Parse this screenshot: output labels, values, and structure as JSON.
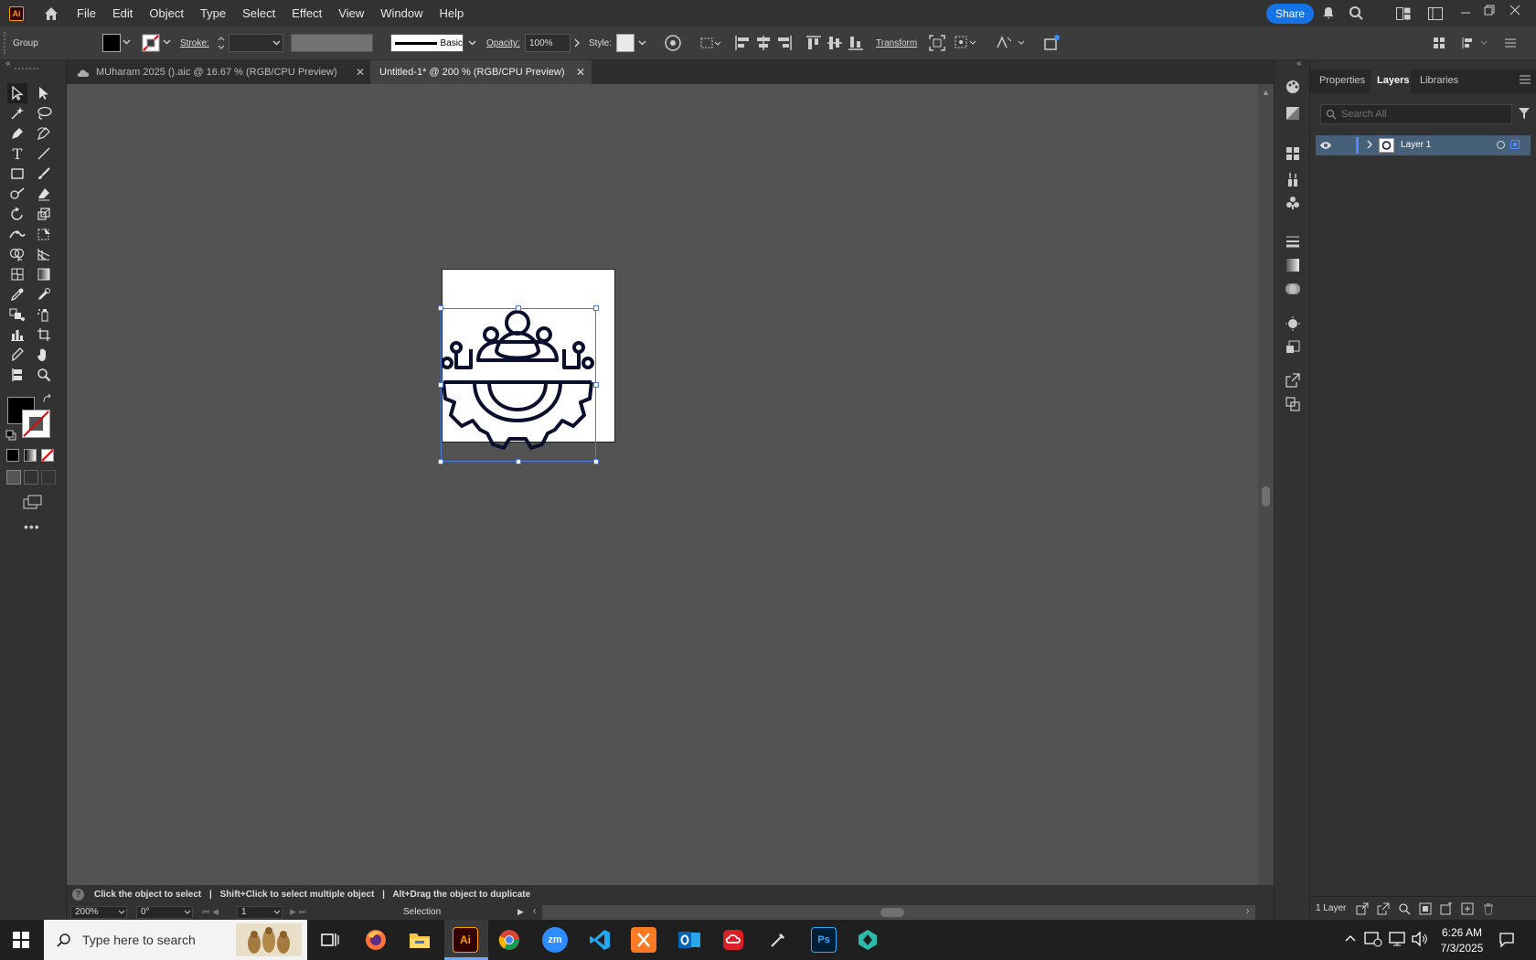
{
  "app": {
    "logo": "Ai",
    "menus": [
      "File",
      "Edit",
      "Object",
      "Type",
      "Select",
      "Effect",
      "View",
      "Window",
      "Help"
    ],
    "share_label": "Share"
  },
  "control_bar": {
    "selection_type": "Group",
    "stroke_label": "Stroke:",
    "stroke_profile": "Basic",
    "opacity_label": "Opacity:",
    "opacity_value": "100%",
    "style_label": "Style:",
    "transform_label": "Transform"
  },
  "tabs": [
    {
      "label": "MUharam 2025 ().aic @ 16.67 % (RGB/CPU Preview)",
      "active": false
    },
    {
      "label": "Untitled-1* @ 200 % (RGB/CPU Preview)",
      "active": true
    }
  ],
  "panel": {
    "tabs": [
      "Properties",
      "Layers",
      "Libraries"
    ],
    "active_tab": "Layers",
    "search_placeholder": "Search All",
    "layers": [
      {
        "name": "Layer 1"
      }
    ],
    "layer_count": "1 Layer"
  },
  "status": {
    "hint_1": "Click the object to select",
    "hint_2": "Shift+Click to select multiple object",
    "hint_3": "Alt+Drag the object to duplicate",
    "separator": "|",
    "zoom": "200%",
    "rotation": "0°",
    "artboard_number": "1",
    "tool_name": "Selection"
  },
  "taskbar": {
    "search_placeholder": "Type here to search",
    "time": "6:26 AM",
    "date": "7/3/2025",
    "apps": [
      "firefox-icon",
      "file-explorer-icon",
      "illustrator-icon",
      "chrome-icon",
      "zoom-icon",
      "vscode-icon",
      "xampp-icon",
      "outlook-icon",
      "creative-cloud-icon",
      "pen-tool-icon",
      "photoshop-icon",
      "app-icon"
    ]
  },
  "colors": {
    "accent": "#1473e6",
    "fill": "#000000",
    "selection": "#4a7bd8",
    "illustration_stroke": "#0b0f2e"
  }
}
